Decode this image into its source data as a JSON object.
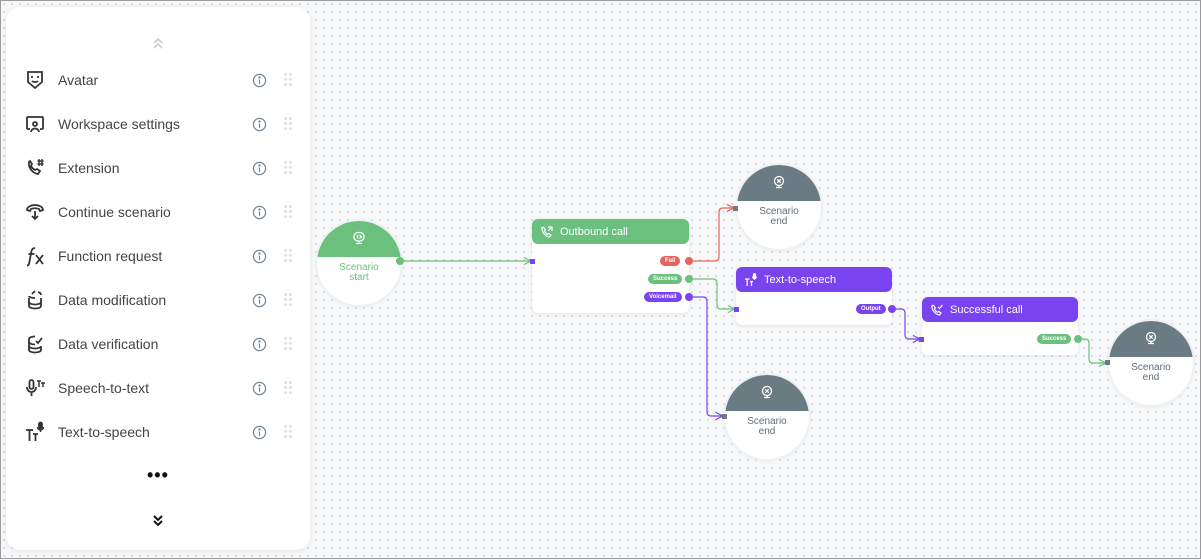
{
  "palette": {
    "scroll_up_icon": "chevrons-up-icon",
    "scroll_down_icon": "chevrons-down-icon",
    "more_label": "•••",
    "items": [
      {
        "label": "Avatar",
        "icon": "avatar-icon"
      },
      {
        "label": "Workspace settings",
        "icon": "workspace-settings-icon"
      },
      {
        "label": "Extension",
        "icon": "phone-extension-icon"
      },
      {
        "label": "Continue scenario",
        "icon": "continue-scenario-icon"
      },
      {
        "label": "Function request",
        "icon": "function-icon"
      },
      {
        "label": "Data modification",
        "icon": "data-modification-icon"
      },
      {
        "label": "Data verification",
        "icon": "data-verification-icon"
      },
      {
        "label": "Speech-to-text",
        "icon": "speech-to-text-icon"
      },
      {
        "label": "Text-to-speech",
        "icon": "text-to-speech-icon"
      }
    ]
  },
  "canvas": {
    "colors": {
      "green": "#6cc07e",
      "purple": "#7a43f0",
      "red": "#e5645d",
      "gray": "#6a7b83"
    },
    "nodes": {
      "start": {
        "line1": "Scenario",
        "line2": "start"
      },
      "outbound": {
        "title": "Outbound call",
        "outputs": [
          "Fail",
          "Success",
          "Voicemail"
        ]
      },
      "end1": {
        "line1": "Scenario",
        "line2": "end"
      },
      "tts": {
        "title": "Text-to-speech",
        "outputs": [
          "Output"
        ]
      },
      "successful": {
        "title": "Successful call",
        "outputs": [
          "Success"
        ]
      },
      "end2": {
        "line1": "Scenario",
        "line2": "end"
      },
      "end3": {
        "line1": "Scenario",
        "line2": "end"
      }
    }
  }
}
